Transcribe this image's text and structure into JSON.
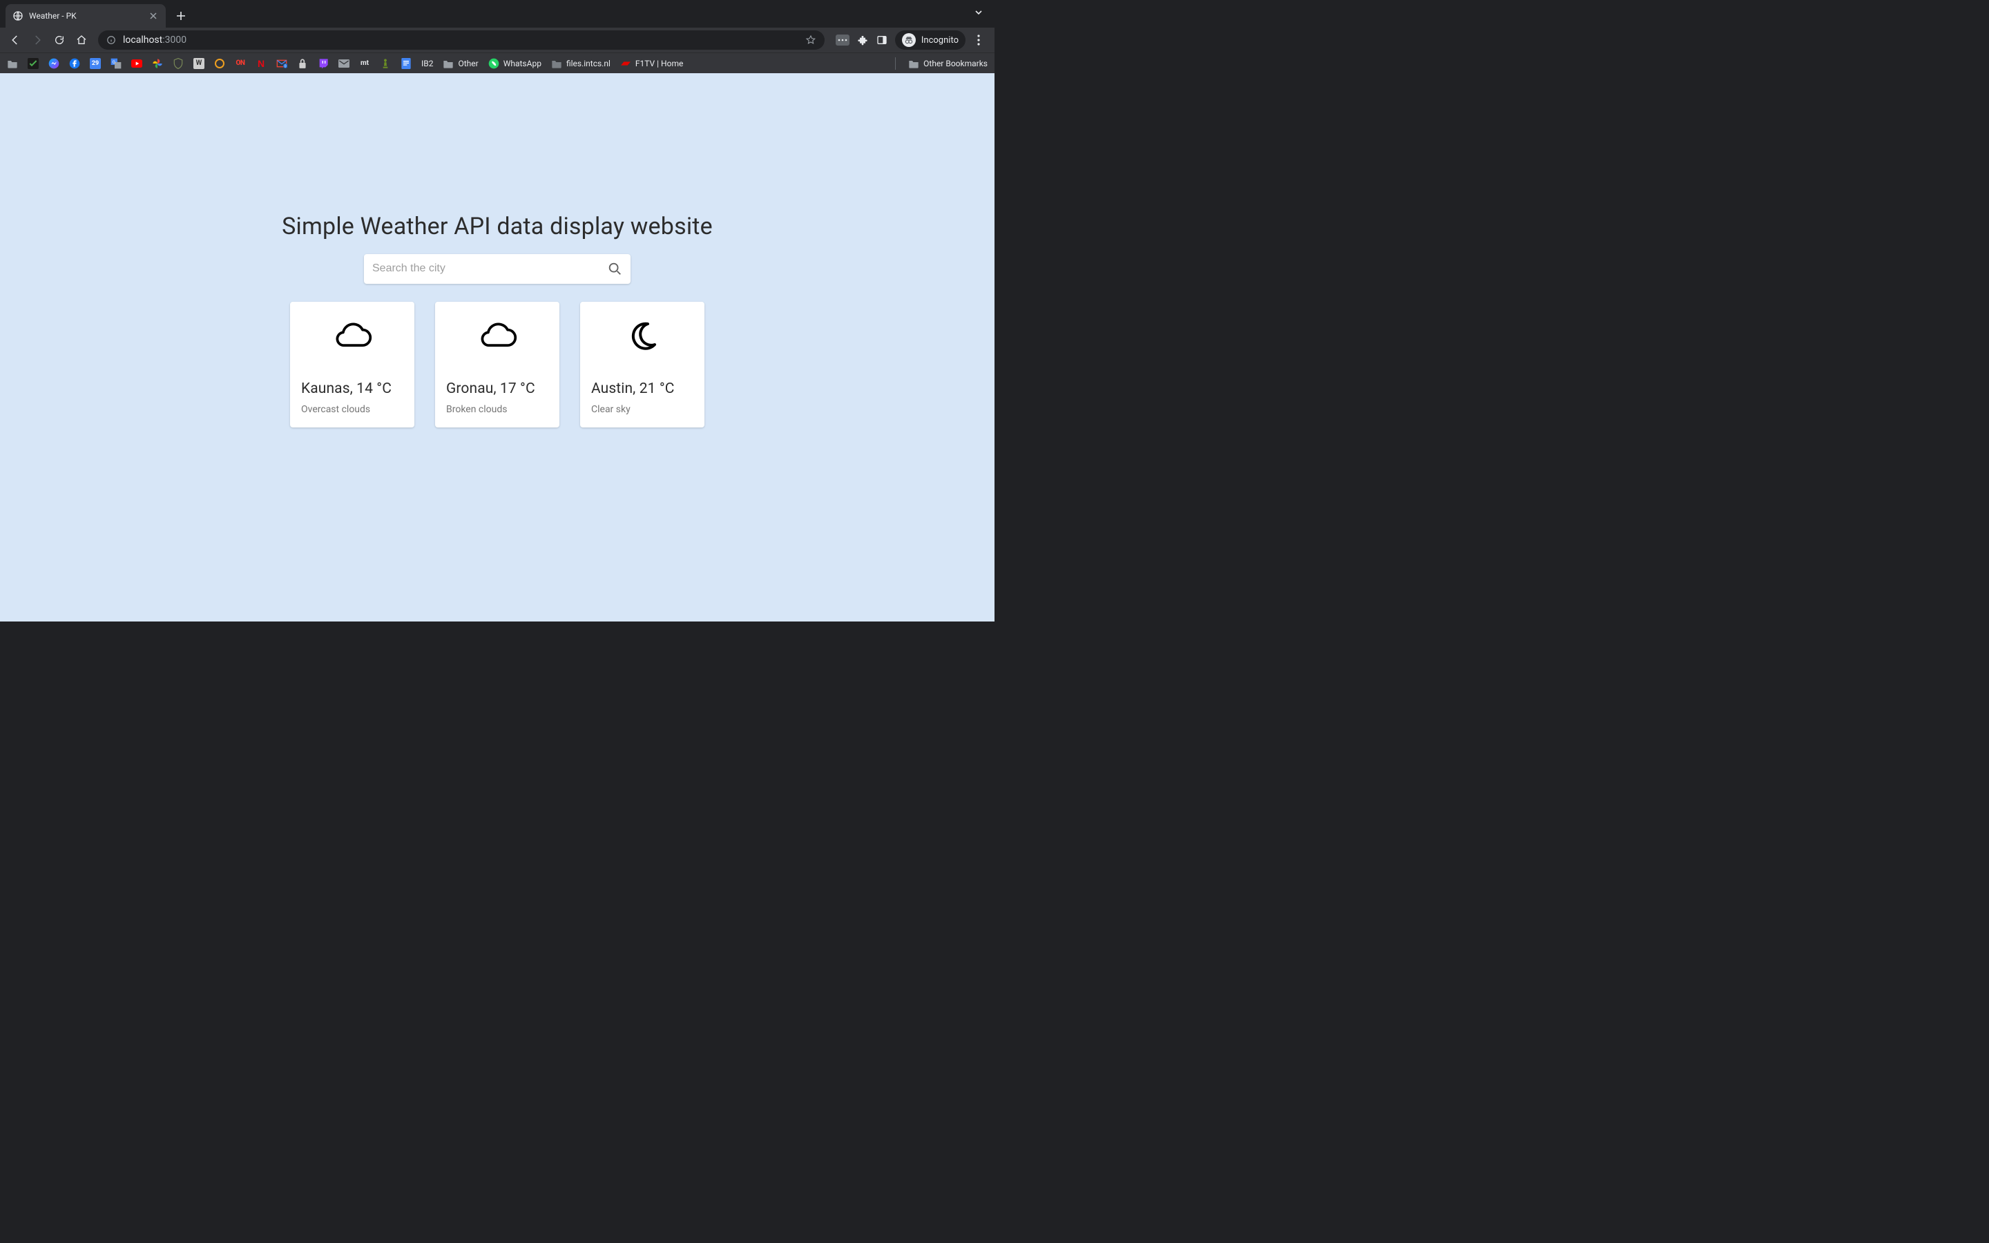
{
  "browser": {
    "tab_title": "Weather - PK",
    "url_host": "localhost",
    "url_port": ":3000",
    "incognito_label": "Incognito",
    "bookmarks": [
      {
        "label": "",
        "icon": "folder",
        "color": "#9aa0a6"
      },
      {
        "label": "",
        "icon": "check",
        "color": "#4caf50"
      },
      {
        "label": "",
        "icon": "messenger",
        "color": "#a946f6"
      },
      {
        "label": "",
        "icon": "facebook",
        "color": "#1877f2"
      },
      {
        "label": "",
        "icon": "cal29",
        "color": "#4285f4"
      },
      {
        "label": "",
        "icon": "translate",
        "color": "#4285f4"
      },
      {
        "label": "",
        "icon": "youtube",
        "color": "#ff0000"
      },
      {
        "label": "",
        "icon": "photos",
        "color": "#ffb300"
      },
      {
        "label": "",
        "icon": "shield",
        "color": "#7a8a57"
      },
      {
        "label": "",
        "icon": "wiki",
        "color": "#c0c0c0"
      },
      {
        "label": "",
        "icon": "circle",
        "color": "#f0a020"
      },
      {
        "label": "",
        "icon": "on",
        "color": "#ff3b30"
      },
      {
        "label": "",
        "icon": "netflix",
        "color": "#e50914"
      },
      {
        "label": "",
        "icon": "mail0",
        "color": "#ea4335"
      },
      {
        "label": "",
        "icon": "lock",
        "color": "#9aa0a6"
      },
      {
        "label": "",
        "icon": "twitch",
        "color": "#9146ff"
      },
      {
        "label": "",
        "icon": "greymail",
        "color": "#9aa0a6"
      },
      {
        "label": "",
        "icon": "mt",
        "color": "#e8eaed"
      },
      {
        "label": "",
        "icon": "pawn",
        "color": "#6b8e23"
      },
      {
        "label": "",
        "icon": "docs",
        "color": "#4285f4"
      },
      {
        "label": "IB2",
        "icon": "",
        "color": ""
      },
      {
        "label": "Other",
        "icon": "folder",
        "color": "#9aa0a6"
      },
      {
        "label": "WhatsApp",
        "icon": "whatsapp",
        "color": "#25d366"
      },
      {
        "label": "files.intcs.nl",
        "icon": "folder-grey",
        "color": "#9aa0a6"
      },
      {
        "label": "F1TV | Home",
        "icon": "f1",
        "color": "#e10600"
      }
    ],
    "other_bookmarks": "Other Bookmarks"
  },
  "page": {
    "title": "Simple Weather API data display website",
    "search_placeholder": "Search the city"
  },
  "cards": [
    {
      "city": "Kaunas",
      "temp": "14 °C",
      "desc": "Overcast clouds",
      "icon": "cloud"
    },
    {
      "city": "Gronau",
      "temp": "17 °C",
      "desc": "Broken clouds",
      "icon": "cloud"
    },
    {
      "city": "Austin",
      "temp": "21 °C",
      "desc": "Clear sky",
      "icon": "moon"
    }
  ]
}
